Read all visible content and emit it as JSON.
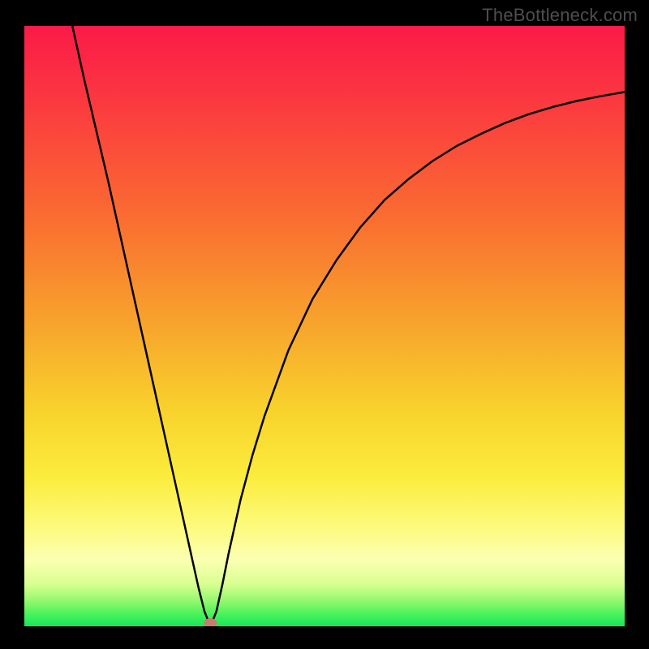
{
  "watermark": "TheBottleneck.com",
  "colors": {
    "curve": "#000000",
    "marker": "#c47d71",
    "frame_bg": "#000000"
  },
  "chart_data": {
    "type": "line",
    "title": "",
    "xlabel": "",
    "ylabel": "",
    "xlim": [
      0,
      100
    ],
    "ylim": [
      0,
      100
    ],
    "grid": false,
    "annotations": [
      {
        "kind": "marker",
        "x": 31,
        "y": 0,
        "shape": "ellipse",
        "color": "#c47d71"
      }
    ],
    "series": [
      {
        "name": "bottleneck",
        "x": [
          8,
          10,
          12,
          14,
          16,
          18,
          20,
          22,
          24,
          26,
          28,
          29,
          30,
          31,
          32,
          33,
          34,
          36,
          38,
          40,
          44,
          48,
          52,
          56,
          60,
          64,
          68,
          72,
          76,
          80,
          84,
          88,
          92,
          96,
          100
        ],
        "y": [
          100,
          91,
          82.5,
          74,
          65,
          56,
          47,
          38,
          29,
          20,
          11,
          6.5,
          2.5,
          0,
          2.5,
          7,
          12,
          21,
          28.5,
          35,
          46,
          54.5,
          61,
          66.5,
          71,
          74.5,
          77.5,
          80,
          82,
          83.8,
          85.3,
          86.5,
          87.5,
          88.3,
          89
        ]
      }
    ]
  }
}
